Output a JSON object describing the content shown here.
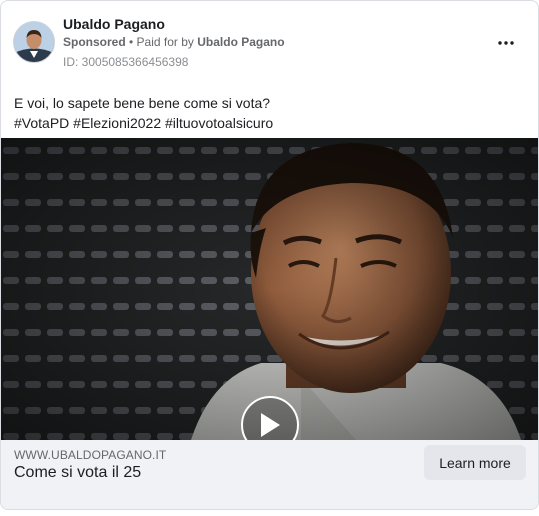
{
  "post": {
    "page_name": "Ubaldo Pagano",
    "sponsored_label": "Sponsored",
    "separator": " • ",
    "paid_for_prefix": "Paid for by ",
    "paid_for_name": "Ubaldo Pagano",
    "ad_id": "ID: 3005085366456398",
    "more_icon": "more-horizontal-icon",
    "caption_line1": "E voi, lo sapete bene bene come si vota?",
    "caption_line2": "#VotaPD #Elezioni2022 #iltuovotoalsicuro"
  },
  "video": {
    "play_icon": "play-icon"
  },
  "link": {
    "domain": "WWW.UBALDOPAGANO.IT",
    "title": "Come si vota il 25",
    "cta_label": "Learn more"
  },
  "colors": {
    "text_primary": "#1c1e21",
    "text_secondary": "#65676b",
    "footer_bg": "#f0f2f5",
    "cta_bg": "#e4e6eb"
  }
}
